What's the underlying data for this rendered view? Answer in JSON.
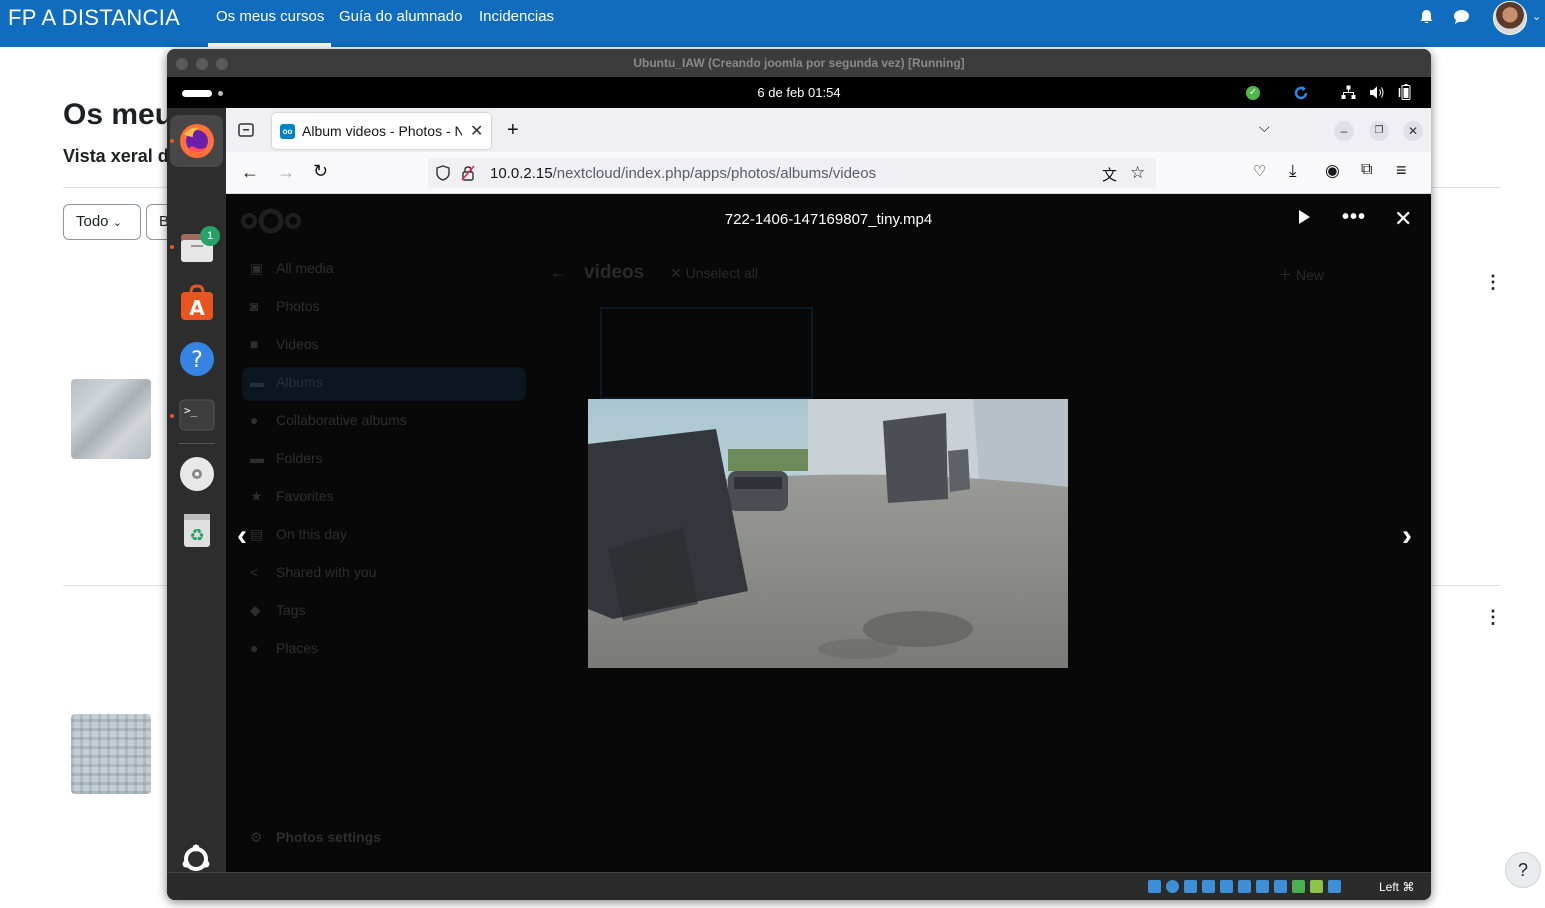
{
  "moodle": {
    "brand": "FP A DISTANCIA",
    "nav": [
      "Os meus cursos",
      "Guía do alumnado",
      "Incidencias"
    ],
    "page_title": "Os meus cursos",
    "subtitle": "Vista xeral de cursos",
    "filter_label": "Todo",
    "second_btn": "B",
    "help": "?"
  },
  "vm": {
    "title": "Ubuntu_IAW (Creando joomla por segunda vez) [Running]",
    "host_key": "Left ⌘"
  },
  "gnome": {
    "clock": "6 de feb  01:54",
    "files_badge": "1"
  },
  "firefox": {
    "tab_title": "Album videos - Photos - Nextcloud",
    "url_host": "10.0.2.15",
    "url_path": "/nextcloud/index.php/apps/photos/albums/videos"
  },
  "nextcloud": {
    "sidebar": [
      "All media",
      "Photos",
      "Videos",
      "Albums",
      "Collaborative albums",
      "Folders",
      "Favorites",
      "On this day",
      "Shared with you",
      "Tags",
      "Places"
    ],
    "settings": "Photos settings",
    "album": "videos",
    "unselect": "Unselect all",
    "new": "New",
    "viewer_title": "722-1406-147169807_tiny.mp4"
  },
  "colors": {
    "moodle_blue": "#0f6cbf",
    "viewer_bg": "#080808",
    "ubuntu_orange": "#e95420"
  }
}
